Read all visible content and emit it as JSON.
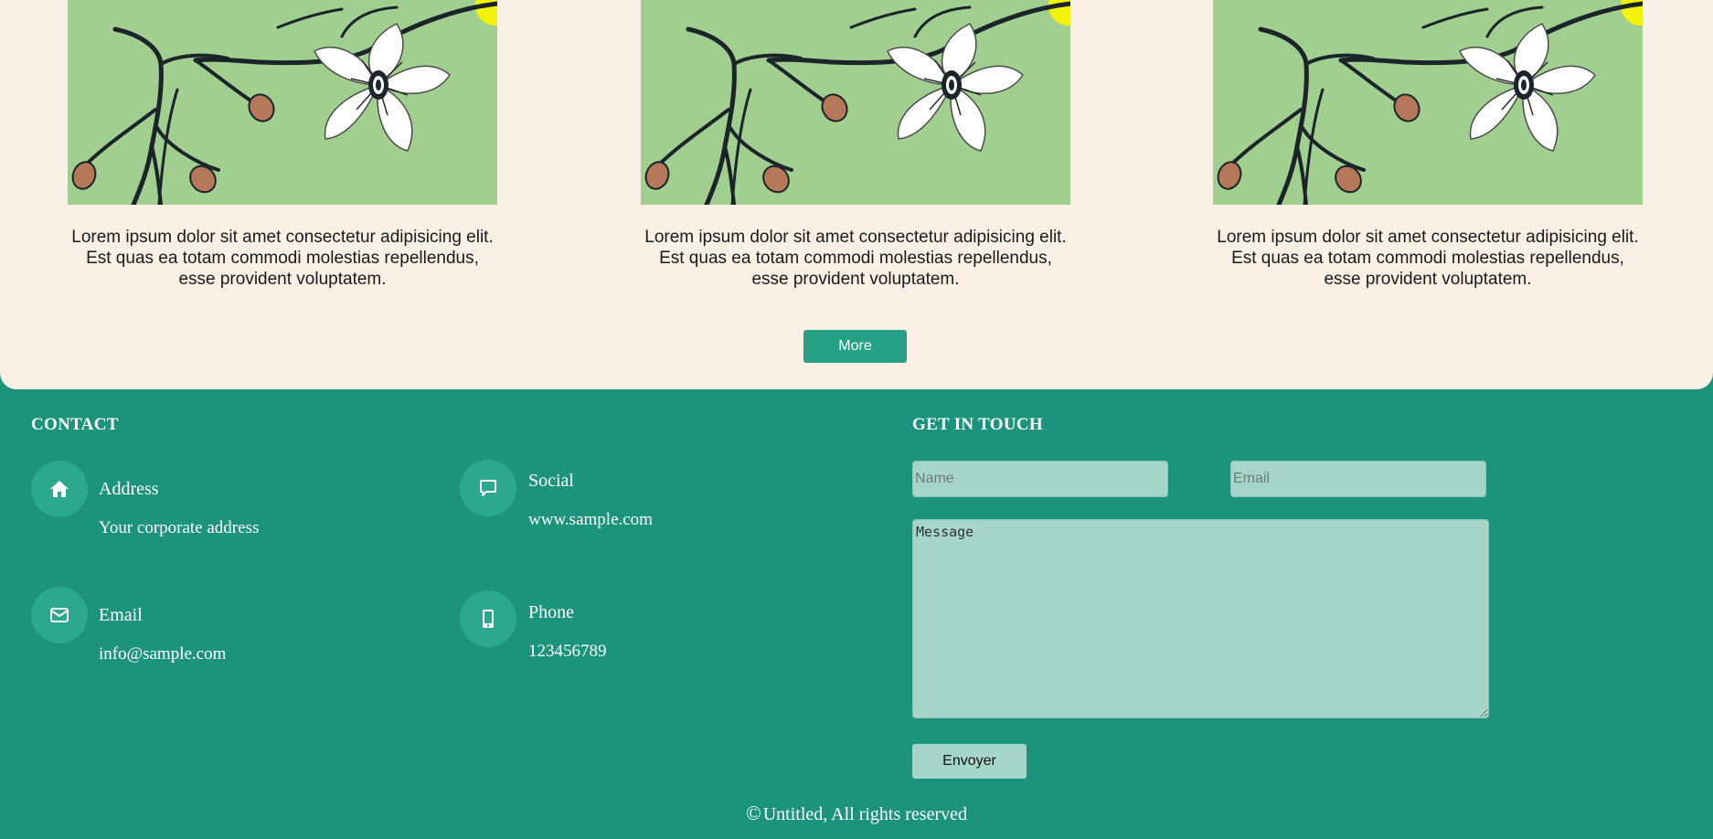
{
  "gallery": {
    "cards": [
      {
        "caption": "Lorem ipsum dolor sit amet consectetur adipisicing elit. Est quas ea totam commodi molestias repellendus, esse provident voluptatem."
      },
      {
        "caption": "Lorem ipsum dolor sit amet consectetur adipisicing elit. Est quas ea totam commodi molestias repellendus, esse provident voluptatem."
      },
      {
        "caption": "Lorem ipsum dolor sit amet consectetur adipisicing elit. Est quas ea totam commodi molestias repellendus, esse provident voluptatem."
      }
    ],
    "more_label": "More"
  },
  "contact": {
    "title": "CONTACT",
    "items": [
      {
        "icon": "home-icon",
        "label": "Address",
        "value": "Your corporate address"
      },
      {
        "icon": "chat-icon",
        "label": "Social",
        "value": "www.sample.com"
      },
      {
        "icon": "envelope-icon",
        "label": "Email",
        "value": "info@sample.com"
      },
      {
        "icon": "mobile-icon",
        "label": "Phone",
        "value": "123456789"
      }
    ]
  },
  "form": {
    "title": "GET IN TOUCH",
    "name_placeholder": "Name",
    "email_placeholder": "Email",
    "message_placeholder": "Message",
    "send_label": "Envoyer"
  },
  "footer": {
    "copyright_symbol": "©",
    "copyright_text": "Untitled, All rights reserved"
  },
  "colors": {
    "footer_bg": "#1c947c",
    "gallery_bg": "#fbf0e6",
    "button_accent": "#25a286",
    "field_bg": "#a6d5ca",
    "image_bg": "#a0cf8f"
  }
}
